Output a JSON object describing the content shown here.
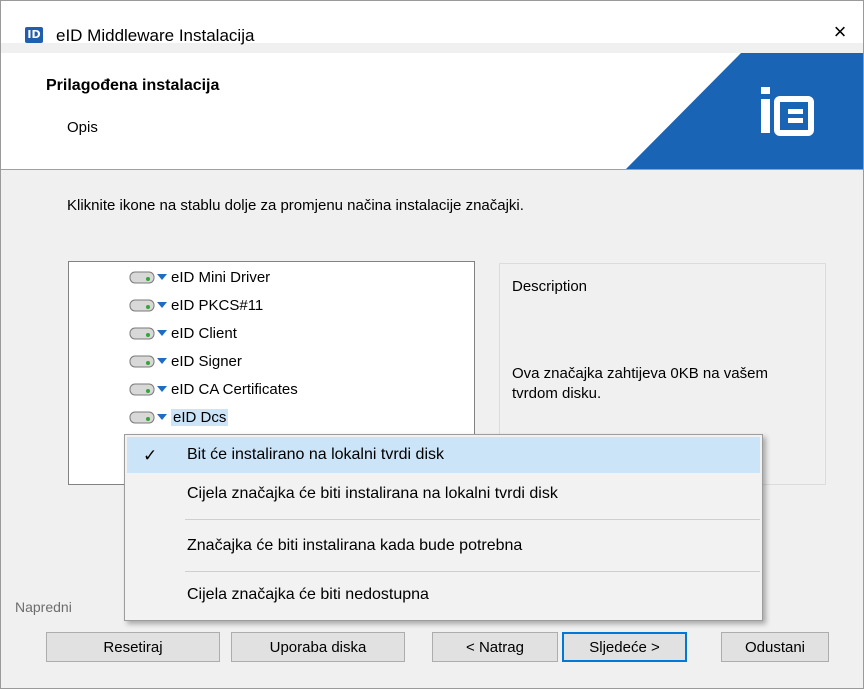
{
  "window": {
    "title": "eID Middleware Instalacija",
    "app_icon_text": "ID",
    "close_glyph": "×"
  },
  "header": {
    "title": "Prilagođena instalacija",
    "subtitle": "Opis",
    "brand_color": "#1a64b6"
  },
  "instruction": "Kliknite ikone na stablu dolje za promjenu načina instalacije značajki.",
  "tree": {
    "items": [
      {
        "label": "eID Mini Driver",
        "icon": "drive-icon"
      },
      {
        "label": "eID PKCS#11",
        "icon": "drive-icon"
      },
      {
        "label": "eID Client",
        "icon": "drive-icon"
      },
      {
        "label": "eID Signer",
        "icon": "drive-icon"
      },
      {
        "label": "eID CA Certificates",
        "icon": "drive-icon"
      },
      {
        "label": "eID Dcs",
        "icon": "drive-icon",
        "selected": true
      }
    ]
  },
  "description": {
    "title": "Description",
    "text": "Ova značajka zahtijeva 0KB na vašem tvrdom disku."
  },
  "group_label": "Napredni",
  "context_menu": {
    "items": [
      {
        "label": "Bit će instalirano na lokalni tvrdi disk",
        "checked": true
      },
      {
        "label": "Cijela značajka će biti instalirana na lokalni tvrdi disk"
      },
      {
        "label": "Značajka će biti instalirana kada bude potrebna"
      },
      {
        "label": "Cijela značajka će biti nedostupna"
      }
    ]
  },
  "buttons": {
    "reset": "Resetiraj",
    "disk_usage": "Uporaba diska",
    "back": "< Natrag",
    "next": "Sljedeće >",
    "cancel": "Odustani"
  }
}
